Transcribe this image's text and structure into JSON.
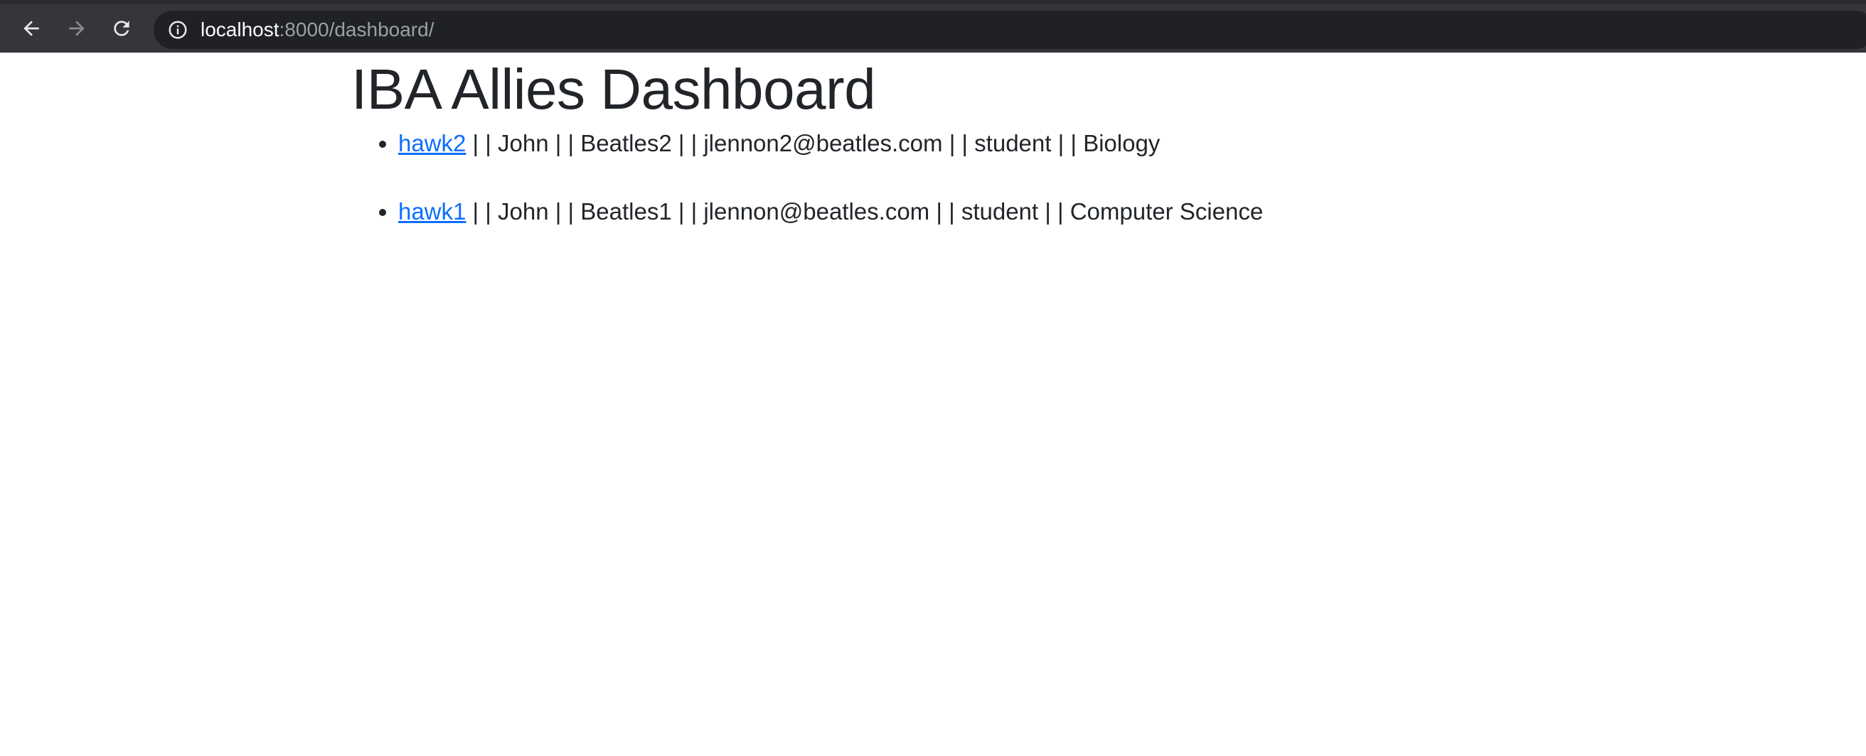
{
  "browser": {
    "url_host": "localhost",
    "url_rest": ":8000/dashboard/"
  },
  "page": {
    "title": "IBA Allies Dashboard"
  },
  "users": [
    {
      "username": "hawk2",
      "details": " | | John | | Beatles2 | | jlennon2@beatles.com | | student | | Biology"
    },
    {
      "username": "hawk1",
      "details": " | | John | | Beatles1 | | jlennon@beatles.com | | student | | Computer Science"
    }
  ],
  "colors": {
    "link": "#0d6efd",
    "text": "#212529",
    "toolbar": "#35363a",
    "omnibox": "#202124"
  },
  "icons": [
    "back-arrow-icon",
    "forward-arrow-icon",
    "reload-icon",
    "info-icon"
  ]
}
